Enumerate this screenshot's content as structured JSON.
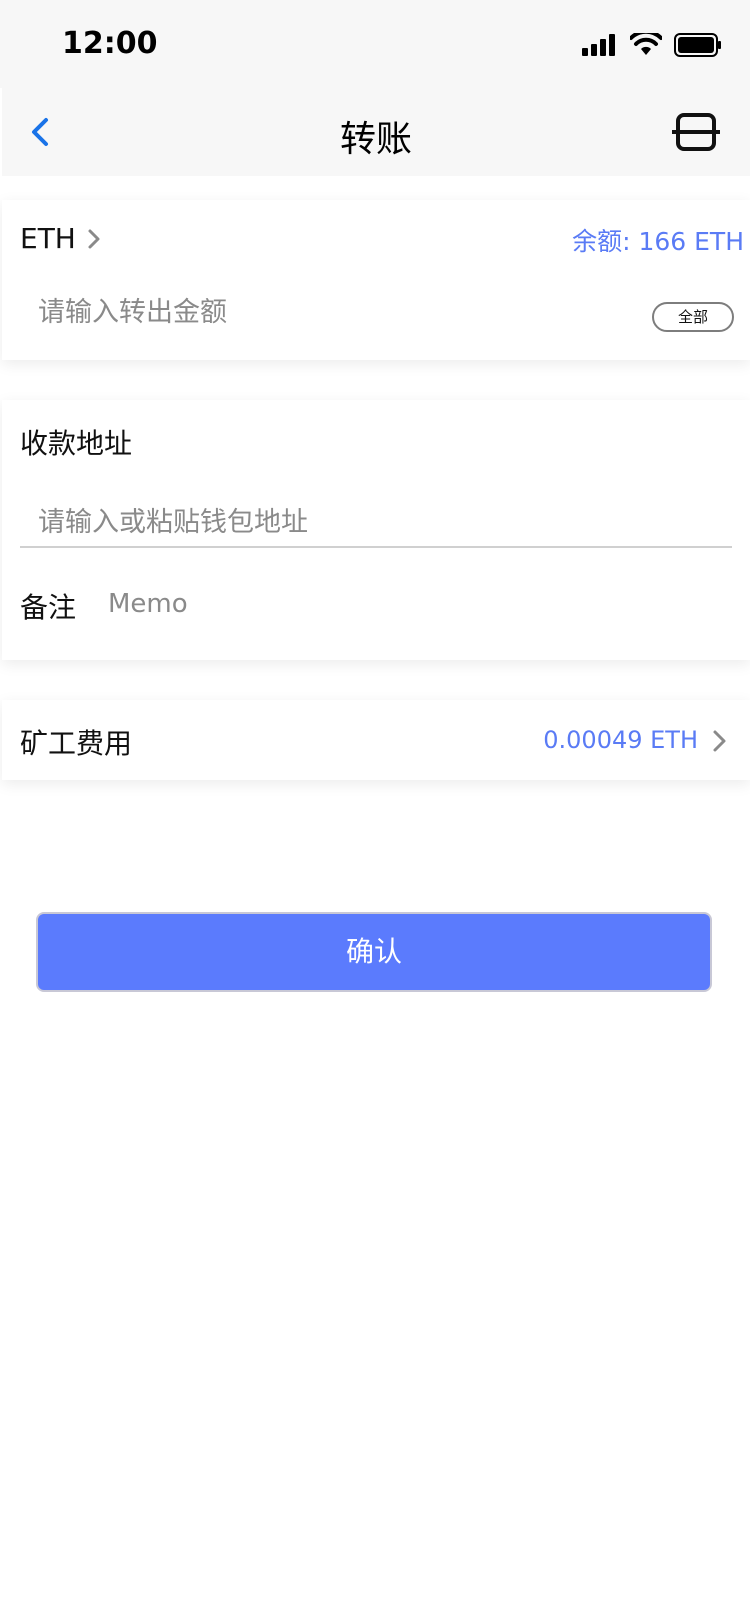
{
  "status_bar": {
    "time": "12:00"
  },
  "nav": {
    "title": "转账",
    "back_icon": "chevron-left-icon",
    "scan_icon": "scan-icon"
  },
  "amount_card": {
    "token": "ETH",
    "balance": "余额: 166 ETH",
    "amount_placeholder": "请输入转出金额",
    "amount_value": "",
    "all_label": "全部"
  },
  "address_card": {
    "address_label": "收款地址",
    "address_placeholder": "请输入或粘贴钱包地址",
    "address_value": "",
    "memo_label": "备注",
    "memo_placeholder": "Memo",
    "memo_value": ""
  },
  "fee_card": {
    "label": "矿工费用",
    "value": "0.00049 ETH"
  },
  "confirm_label": "确认",
  "colors": {
    "accent": "#5b7bfd",
    "link_blue": "#5a7bf5",
    "back_blue": "#1a73e8",
    "nav_bg": "#f7f7f7"
  }
}
